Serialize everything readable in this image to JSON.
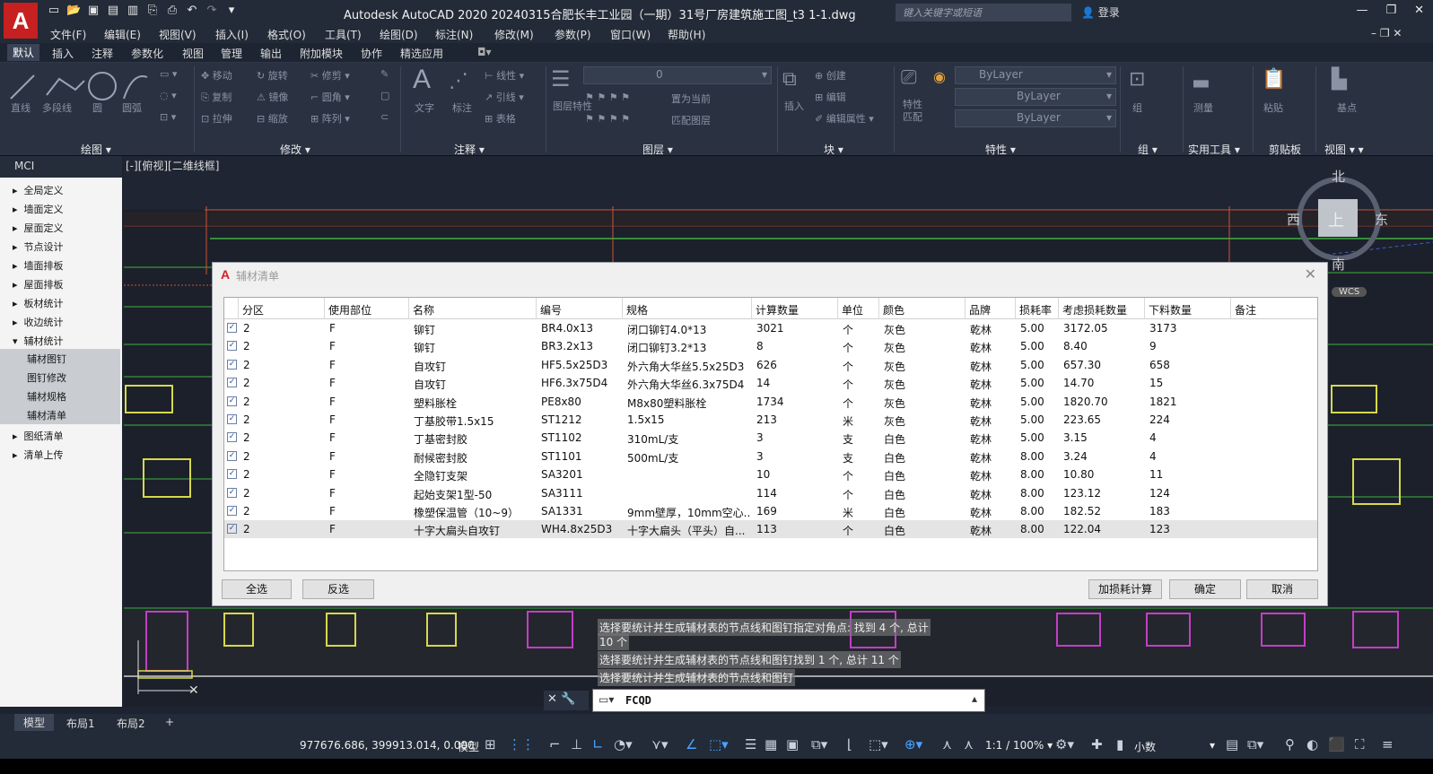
{
  "app": {
    "logo": "A",
    "window_title": "Autodesk AutoCAD 2020    20240315合肥长丰工业园（一期）31号厂房建筑施工图_t3 1-1.dwg",
    "search_placeholder": "键入关键字或短语",
    "login": "登录",
    "win_controls": [
      "—",
      "❐",
      "✕"
    ]
  },
  "menu": [
    "文件(F)",
    "编辑(E)",
    "视图(V)",
    "插入(I)",
    "格式(O)",
    "工具(T)",
    "绘图(D)",
    "标注(N)",
    "修改(M)",
    "参数(P)",
    "窗口(W)",
    "帮助(H)"
  ],
  "ribbon_tabs": [
    "默认",
    "插入",
    "注释",
    "参数化",
    "视图",
    "管理",
    "输出",
    "附加模块",
    "协作",
    "精选应用"
  ],
  "ribbon": {
    "draw_tools": [
      "直线",
      "多段线",
      "圆",
      "圆弧"
    ],
    "modify_tools": [
      "移动",
      "旋转",
      "修剪",
      "复制",
      "镜像",
      "圆角",
      "拉伸",
      "缩放",
      "阵列"
    ],
    "annotate_tools": [
      "文字",
      "标注",
      "线性",
      "引线",
      "表格"
    ],
    "layer_tools": [
      "图层特性",
      "置为当前",
      "匹配图层"
    ],
    "layer_value": "0",
    "block_tools": [
      "插入",
      "创建",
      "编辑",
      "编辑属性"
    ],
    "properties": {
      "match": "特性匹配",
      "color": "ByLayer",
      "linetype": "ByLayer",
      "lineweight": "ByLayer"
    },
    "other_tools": [
      "组",
      "测量",
      "粘贴",
      "基点"
    ],
    "panels": [
      "绘图",
      "修改",
      "注释",
      "图层",
      "块",
      "特性",
      "组",
      "实用工具",
      "剪贴板",
      "视图"
    ]
  },
  "side_panel": {
    "title": "MCI",
    "items": [
      "全局定义",
      "墙面定义",
      "屋面定义",
      "节点设计",
      "墙面排板",
      "屋面排板",
      "板材统计",
      "收边统计",
      "辅材统计"
    ],
    "sub_items": [
      "辅材图钉",
      "图钉修改",
      "辅材规格",
      "辅材清单"
    ],
    "items_after": [
      "图纸清单",
      "清单上传"
    ]
  },
  "viewport_label": "[-][俯视][二维线框]",
  "compass": {
    "north": "北",
    "south": "南",
    "east": "东",
    "west": "西",
    "top": "上",
    "wcs": "WCS"
  },
  "dialog": {
    "title": "辅材清单",
    "columns": [
      "分区",
      "使用部位",
      "名称",
      "编号",
      "规格",
      "计算数量",
      "单位",
      "颜色",
      "品牌",
      "损耗率",
      "考虑损耗数量",
      "下料数量",
      "备注"
    ],
    "rows": [
      [
        "2",
        "F",
        "铆钉",
        "BR4.0x13",
        "闭口铆钉4.0*13",
        "3021",
        "个",
        "灰色",
        "乾林",
        "5.00",
        "3172.05",
        "3173",
        ""
      ],
      [
        "2",
        "F",
        "铆钉",
        "BR3.2x13",
        "闭口铆钉3.2*13",
        "8",
        "个",
        "灰色",
        "乾林",
        "5.00",
        "8.40",
        "9",
        ""
      ],
      [
        "2",
        "F",
        "自攻钉",
        "HF5.5x25D3",
        "外六角大华丝5.5x25D3",
        "626",
        "个",
        "灰色",
        "乾林",
        "5.00",
        "657.30",
        "658",
        ""
      ],
      [
        "2",
        "F",
        "自攻钉",
        "HF6.3x75D4",
        "外六角大华丝6.3x75D4",
        "14",
        "个",
        "灰色",
        "乾林",
        "5.00",
        "14.70",
        "15",
        ""
      ],
      [
        "2",
        "F",
        "塑料胀栓",
        "PE8x80",
        "M8x80塑料胀栓",
        "1734",
        "个",
        "灰色",
        "乾林",
        "5.00",
        "1820.70",
        "1821",
        ""
      ],
      [
        "2",
        "F",
        "丁基胶带1.5x15",
        "ST1212",
        "1.5x15",
        "213",
        "米",
        "灰色",
        "乾林",
        "5.00",
        "223.65",
        "224",
        ""
      ],
      [
        "2",
        "F",
        "丁基密封胶",
        "ST1102",
        "310mL/支",
        "3",
        "支",
        "白色",
        "乾林",
        "5.00",
        "3.15",
        "4",
        ""
      ],
      [
        "2",
        "F",
        "耐候密封胶",
        "ST1101",
        "500mL/支",
        "3",
        "支",
        "白色",
        "乾林",
        "8.00",
        "3.24",
        "4",
        ""
      ],
      [
        "2",
        "F",
        "全隐钉支架",
        "SA3201",
        "",
        "10",
        "个",
        "白色",
        "乾林",
        "8.00",
        "10.80",
        "11",
        ""
      ],
      [
        "2",
        "F",
        "起始支架1型-50",
        "SA3111",
        "",
        "114",
        "个",
        "白色",
        "乾林",
        "8.00",
        "123.12",
        "124",
        ""
      ],
      [
        "2",
        "F",
        "橡塑保温管（10~9）",
        "SA1331",
        "9mm壁厚，10mm空心...",
        "169",
        "米",
        "白色",
        "乾林",
        "8.00",
        "182.52",
        "183",
        ""
      ],
      [
        "2",
        "F",
        "十字大扁头自攻钉",
        "WH4.8x25D3",
        "十字大扁头（平头）自...",
        "113",
        "个",
        "白色",
        "乾林",
        "8.00",
        "122.04",
        "123",
        ""
      ]
    ],
    "buttons": {
      "select_all": "全选",
      "invert": "反选",
      "add_loss": "加损耗计算",
      "ok": "确定",
      "cancel": "取消"
    }
  },
  "command": {
    "history": [
      "选择要统计并生成辅材表的节点线和图钉指定对角点: 找到 4 个, 总计",
      "10 个",
      "选择要统计并生成辅材表的节点线和图钉找到 1 个, 总计 11 个",
      "选择要统计并生成辅材表的节点线和图钉"
    ],
    "input": "FCQD"
  },
  "layout_tabs": [
    "模型",
    "布局1",
    "布局2"
  ],
  "status": {
    "coords": "977676.686, 399913.014, 0.000",
    "model": "模型",
    "scale": "1:1 / 100%",
    "units": "小数"
  }
}
